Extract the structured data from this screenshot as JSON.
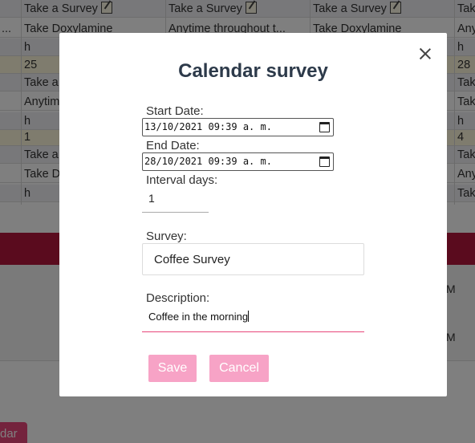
{
  "background": {
    "rows": [
      {
        "cells": [
          "",
          "Take a Survey",
          "Take a Survey",
          "Take a Survey",
          "Tak"
        ],
        "icons": [
          false,
          true,
          true,
          true,
          false
        ],
        "bg": "#f0f0f4"
      },
      {
        "cells": [
          "...",
          "Take Doxylamine",
          "Anytime throughout t...",
          "Take Doxylamine",
          "Any"
        ],
        "icons": [
          false,
          false,
          false,
          false,
          false
        ],
        "bg": "#ffffff"
      },
      {
        "cells": [
          "",
          "h",
          "h",
          "h",
          "h"
        ],
        "icons": [
          false,
          false,
          false,
          false,
          false
        ],
        "bg": "#f0f0f4"
      },
      {
        "cells": [
          "",
          "25",
          "",
          "",
          "28"
        ],
        "icons": [
          false,
          false,
          false,
          false,
          false
        ],
        "bg": "#fff8dc"
      },
      {
        "cells": [
          "",
          "Take a",
          "",
          "",
          "Tak"
        ],
        "icons": [
          false,
          false,
          false,
          false,
          false
        ],
        "bg": "#f0f0f4"
      },
      {
        "cells": [
          "",
          "Anytim",
          "",
          "",
          "Tak"
        ],
        "icons": [
          false,
          false,
          false,
          false,
          false
        ],
        "bg": "#ffffff"
      },
      {
        "cells": [
          "",
          "h",
          "",
          "",
          "h"
        ],
        "icons": [
          false,
          false,
          false,
          false,
          false
        ],
        "bg": "#f0f0f4"
      },
      {
        "cells": [
          "",
          "1",
          "",
          "",
          "4"
        ],
        "icons": [
          false,
          false,
          false,
          false,
          false
        ],
        "bg": "#fff8dc"
      },
      {
        "cells": [
          "",
          "Take a",
          "",
          "",
          "Tak"
        ],
        "icons": [
          false,
          false,
          false,
          false,
          false
        ],
        "bg": "#f0f0f4"
      },
      {
        "cells": [
          "",
          "Take D",
          "",
          "",
          "Any"
        ],
        "icons": [
          false,
          false,
          false,
          false,
          false
        ],
        "bg": "#ffffff"
      },
      {
        "cells": [
          "",
          "h",
          "",
          "",
          "Tak"
        ],
        "icons": [
          false,
          false,
          false,
          false,
          false
        ],
        "bg": "#f0f0f4"
      }
    ],
    "side_text": [
      "M",
      "M"
    ],
    "bottom_button": "dar",
    "band_color": "#b5173c"
  },
  "modal": {
    "title": "Calendar survey",
    "start_label": "Start Date:",
    "start_value": "13/10/2021  09:39  a. m.",
    "end_label": "End Date:",
    "end_value": "28/10/2021  09:39  a. m.",
    "interval_label": "Interval days:",
    "interval_value": "1",
    "survey_label": "Survey:",
    "survey_value": "Coffee Survey",
    "description_label": "Description:",
    "description_value": "Coffee in the morning",
    "save_label": "Save",
    "cancel_label": "Cancel",
    "accent_color": "#e8477a",
    "button_color": "#f7a3c6"
  }
}
